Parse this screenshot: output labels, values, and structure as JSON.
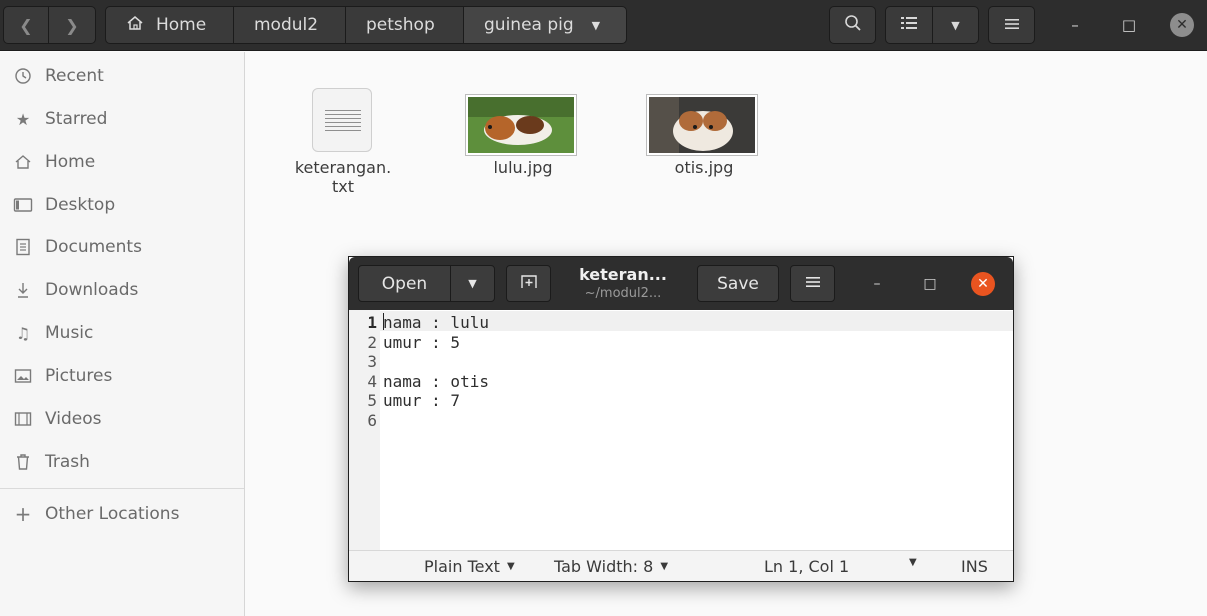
{
  "header": {
    "back_icon": "chevron-left-icon",
    "forward_icon": "chevron-right-icon",
    "breadcrumbs": [
      "Home",
      "modul2",
      "petshop",
      "guinea pig"
    ],
    "dropdown_icon": "chevron-down-icon",
    "search_icon": "search-icon",
    "view_icon": "list-view-icon",
    "menu_icon": "hamburger-icon"
  },
  "sidebar": {
    "items": [
      {
        "label": "Recent",
        "icon": "clock-icon"
      },
      {
        "label": "Starred",
        "icon": "star-icon"
      },
      {
        "label": "Home",
        "icon": "home-icon"
      },
      {
        "label": "Desktop",
        "icon": "desktop-icon"
      },
      {
        "label": "Documents",
        "icon": "document-icon"
      },
      {
        "label": "Downloads",
        "icon": "download-icon"
      },
      {
        "label": "Music",
        "icon": "music-icon"
      },
      {
        "label": "Pictures",
        "icon": "picture-icon"
      },
      {
        "label": "Videos",
        "icon": "video-icon"
      },
      {
        "label": "Trash",
        "icon": "trash-icon"
      },
      {
        "label": "Other Locations",
        "icon": "plus-icon"
      }
    ]
  },
  "files": [
    {
      "name_line1": "keterangan.",
      "name_line2": "txt",
      "type": "text"
    },
    {
      "name_line1": "lulu.jpg",
      "type": "image"
    },
    {
      "name_line1": "otis.jpg",
      "type": "image"
    }
  ],
  "editor": {
    "open_label": "Open",
    "save_label": "Save",
    "title": "keteran...",
    "subtitle": "~/modul2...",
    "line_numbers": [
      "1",
      "2",
      "3",
      "4",
      "5",
      "6"
    ],
    "lines": [
      "nama : lulu",
      "umur : 5",
      "",
      "nama : otis",
      "umur : 7",
      ""
    ],
    "status": {
      "language": "Plain Text",
      "tab_width": "Tab Width: 8",
      "position": "Ln 1, Col 1",
      "mode": "INS"
    },
    "accent_close": "#e95420"
  }
}
